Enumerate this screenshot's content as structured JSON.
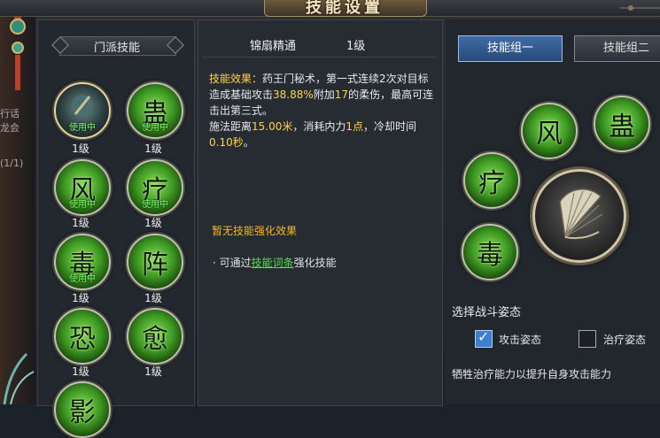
{
  "window": {
    "title": "技能设置"
  },
  "left_panel": {
    "header": "门派技能",
    "skills": [
      {
        "glyph": "",
        "status": "使用中",
        "level": "1级",
        "selected": true
      },
      {
        "glyph": "蛊",
        "status": "使用中",
        "level": "1级"
      },
      {
        "glyph": "风",
        "status": "使用中",
        "level": "1级"
      },
      {
        "glyph": "疗",
        "status": "使用中",
        "level": "1级"
      },
      {
        "glyph": "毒",
        "status": "使用中",
        "level": "1级"
      },
      {
        "glyph": "阵",
        "status": "",
        "level": "1级"
      },
      {
        "glyph": "恐",
        "status": "",
        "level": "1级"
      },
      {
        "glyph": "愈",
        "status": "",
        "level": "1级"
      },
      {
        "glyph": "影",
        "status": "",
        "level": ""
      }
    ]
  },
  "left_edge": {
    "text_1": "行话",
    "text_2": "龙会",
    "text_3": "(1/1)"
  },
  "detail": {
    "skill_name": "锦扇精通",
    "skill_level": "1级",
    "effect_label": "技能效果：",
    "effect_p1": "药王门秘术，第一式连续2次对目标造成基础攻击",
    "effect_pct": "38.88%",
    "effect_p2": "附加",
    "effect_dmg": "17",
    "effect_p3": "的柔伤，最高可连击出第三式。",
    "effect_p4": "施法距离",
    "effect_range": "15.00米",
    "effect_p5": "，消耗内力",
    "effect_cost": "1点",
    "effect_p6": "，冷却时间",
    "effect_cd": "0.10秒",
    "effect_p7": "。",
    "enhance_text": "暂无技能强化效果",
    "hint_prefix": "· 可通过",
    "hint_link": "技能词条",
    "hint_suffix": "强化技能"
  },
  "right_panel": {
    "tab_1": "技能组一",
    "tab_2": "技能组二",
    "group_skills": [
      "风",
      "蛊",
      "疗",
      "毒"
    ],
    "stance_title": "选择战斗姿态",
    "stance_attack": "攻击姿态",
    "stance_heal": "治疗姿态",
    "stance_attack_checked": true,
    "stance_heal_checked": false,
    "stance_desc": "牺牲治疗能力以提升自身攻击能力"
  },
  "colors": {
    "accent_blue": "#3f6ca7",
    "highlight_yellow": "#ffd34a",
    "enhance_orange": "#ffb320",
    "link_green": "#54e04a",
    "inuse_green": "#7dff6e"
  }
}
